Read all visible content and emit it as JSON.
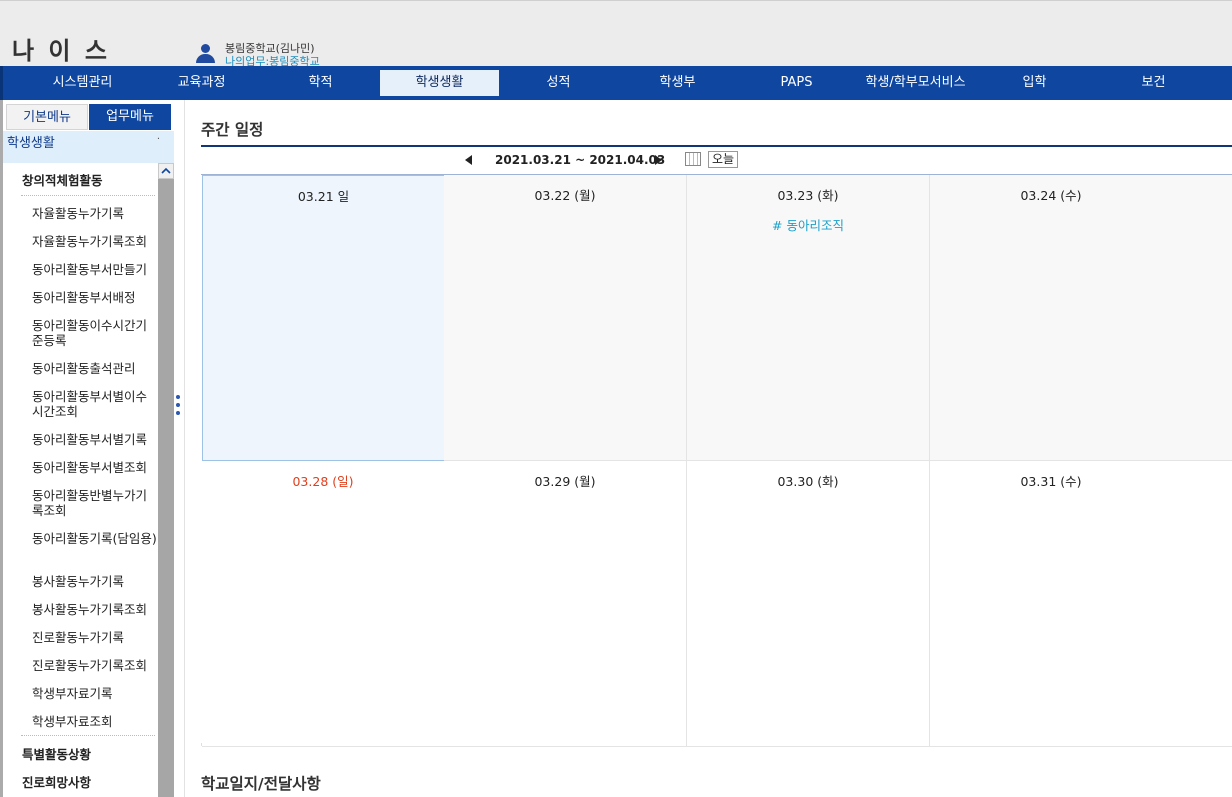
{
  "header": {
    "logo": "나 이 스",
    "user_name": "봉림중학교(김나민)",
    "user_work": "나의업무:봉림중학교"
  },
  "nav": [
    {
      "label": "시스템관리"
    },
    {
      "label": "교육과정"
    },
    {
      "label": "학적"
    },
    {
      "label": "학생생활",
      "active": true
    },
    {
      "label": "성적"
    },
    {
      "label": "학생부"
    },
    {
      "label": "PAPS"
    },
    {
      "label": "학생/학부모서비스"
    },
    {
      "label": "입학"
    },
    {
      "label": "보건"
    }
  ],
  "sidebar": {
    "tab_basic": "기본메뉴",
    "tab_work": "업무메뉴",
    "section": "학생생활",
    "section_mark": "·",
    "items": [
      {
        "label": "창의적체험활동",
        "level": 1
      },
      {
        "label": "자율활동누가기록",
        "level": 2
      },
      {
        "label": "자율활동누가기록조회",
        "level": 2
      },
      {
        "label": "동아리활동부서만들기",
        "level": 2
      },
      {
        "label": "동아리활동부서배정",
        "level": 2
      },
      {
        "label": "동아리활동이수시간기준등록",
        "level": 2
      },
      {
        "label": "동아리활동출석관리",
        "level": 2
      },
      {
        "label": "동아리활동부서별이수시간조회",
        "level": 2
      },
      {
        "label": "동아리활동부서별기록",
        "level": 2
      },
      {
        "label": "동아리활동부서별조회",
        "level": 2
      },
      {
        "label": "동아리활동반별누가기록조회",
        "level": 2
      },
      {
        "label": "동아리활동기록(담임용)",
        "level": 2
      },
      {
        "label": "봉사활동누가기록",
        "level": 2
      },
      {
        "label": "봉사활동누가기록조회",
        "level": 2
      },
      {
        "label": "진로활동누가기록",
        "level": 2
      },
      {
        "label": "진로활동누가기록조회",
        "level": 2
      },
      {
        "label": "학생부자료기록",
        "level": 2
      },
      {
        "label": "학생부자료조회",
        "level": 2
      },
      {
        "label": "특별활동상황",
        "level": 1
      },
      {
        "label": "진로희망사항",
        "level": 1
      }
    ]
  },
  "schedule": {
    "title": "주간 일정",
    "range": "2021.03.21 ~ 2021.04.03",
    "today_label": "오늘",
    "days": [
      {
        "date": "03.21 일",
        "today": true,
        "events": []
      },
      {
        "date": "03.22 (월)",
        "events": []
      },
      {
        "date": "03.23 (화)",
        "events": [
          "# 동아리조직"
        ]
      },
      {
        "date": "03.24 (수)",
        "events": []
      },
      {
        "date": "",
        "events": []
      },
      {
        "date": "03.28 (일)",
        "sunday": true,
        "events": []
      },
      {
        "date": "03.29 (월)",
        "events": []
      },
      {
        "date": "03.30 (화)",
        "events": []
      },
      {
        "date": "03.31 (수)",
        "events": []
      },
      {
        "date": "",
        "events": []
      }
    ]
  },
  "journal": {
    "title": "학교일지/전달사항"
  }
}
